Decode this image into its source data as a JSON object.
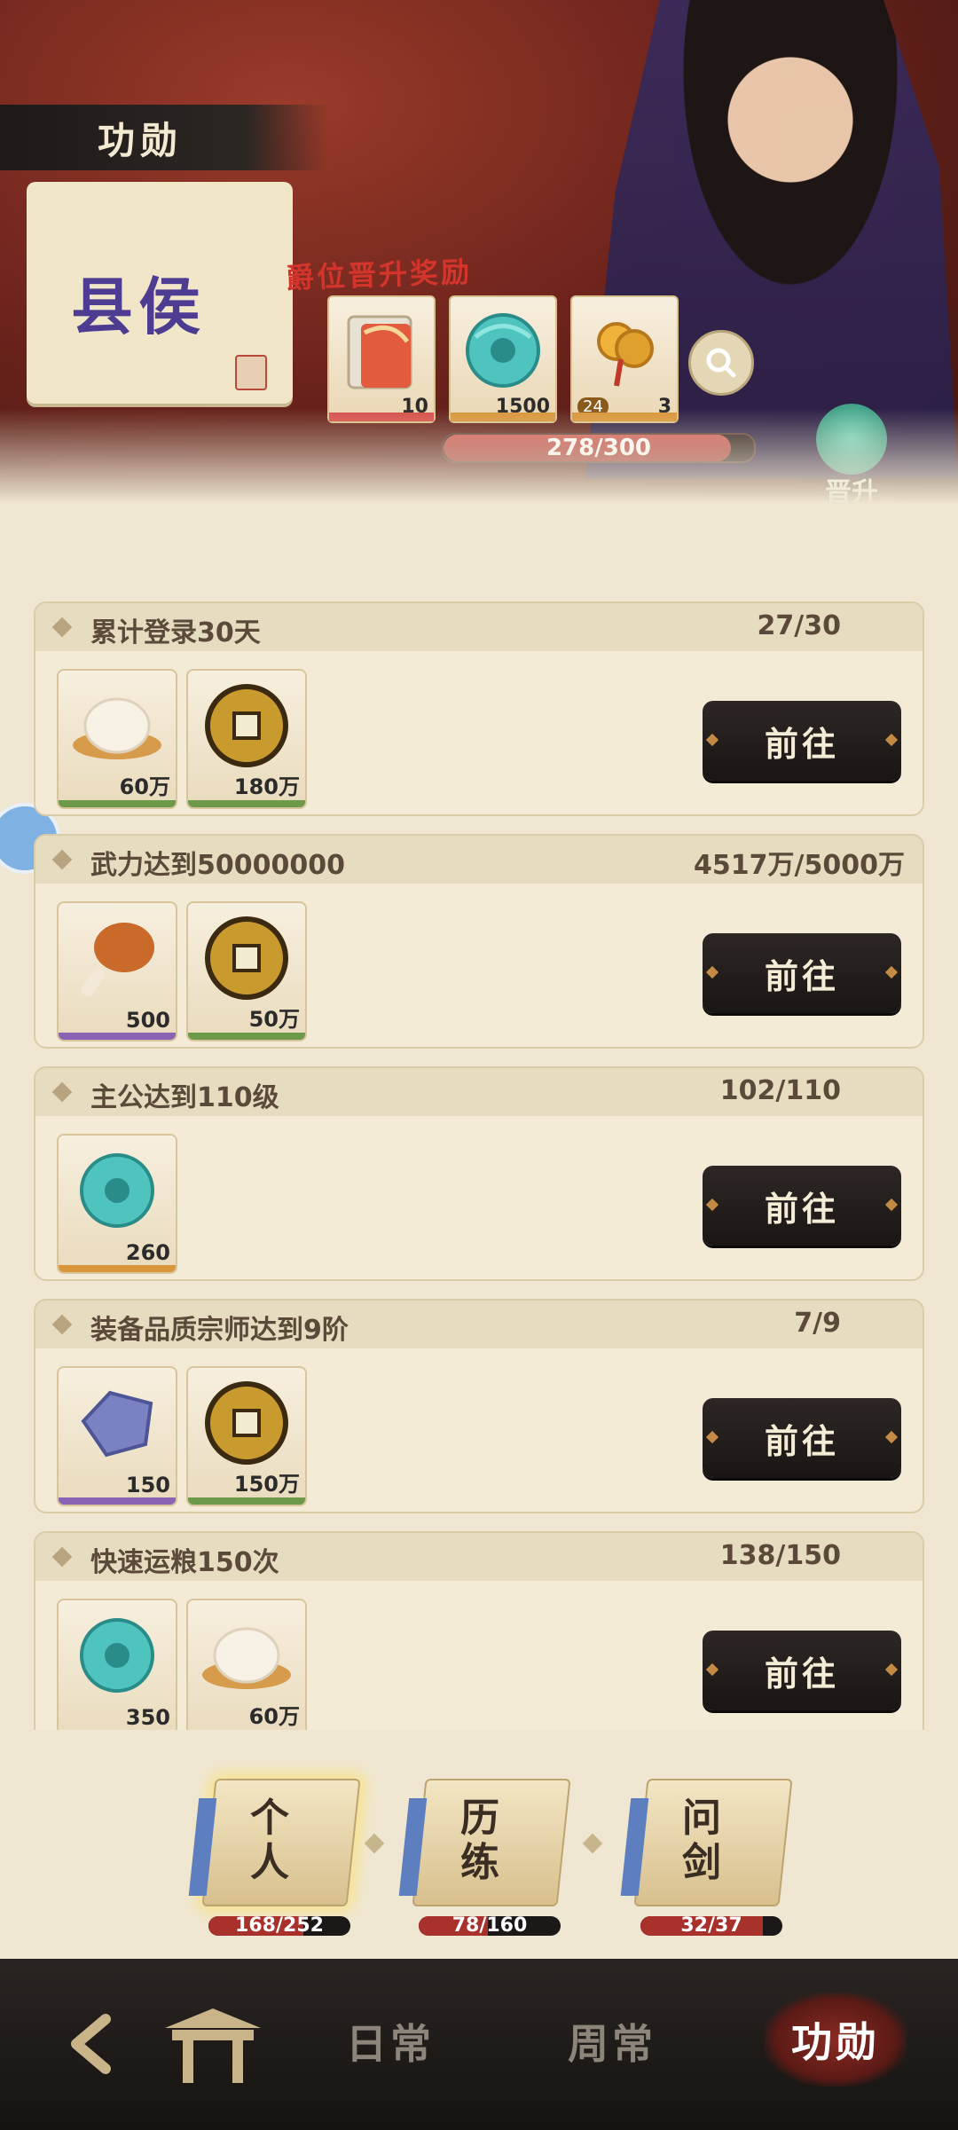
{
  "header": {
    "title": "功勋",
    "rank": "县侯",
    "reward_label": "爵位晋升奖励",
    "rewards": [
      {
        "icon": "scroll-pack-icon",
        "count": "10",
        "rarity_color": "#d6504a"
      },
      {
        "icon": "jade-dragon-icon",
        "count": "1500",
        "rarity_color": "#d8953a"
      },
      {
        "icon": "coin-string-icon",
        "level": "24",
        "count": "3",
        "rarity_color": "#d8953a"
      }
    ],
    "progress": {
      "text": "278/300",
      "fraction": 0.9267
    },
    "promote_label": "晋升"
  },
  "tasks": [
    {
      "title": "累计登录30天",
      "progress": "27/30",
      "button": "前往",
      "items": [
        {
          "icon": "steamed-bun-icon",
          "count": "60万",
          "rarity_color": "#6d9a4a"
        },
        {
          "icon": "copper-coin-icon",
          "count": "180万",
          "rarity_color": "#6d9a4a"
        }
      ]
    },
    {
      "title": "武力达到50000000",
      "progress": "4517万/5000万",
      "button": "前往",
      "items": [
        {
          "icon": "chicken-leg-icon",
          "count": "500",
          "rarity_color": "#8a63b5"
        },
        {
          "icon": "copper-coin-icon",
          "count": "50万",
          "rarity_color": "#6d9a4a"
        }
      ]
    },
    {
      "title": "主公达到110级",
      "progress": "102/110",
      "button": "前往",
      "items": [
        {
          "icon": "jade-dragon-icon",
          "count": "260",
          "rarity_color": "#d8953a"
        }
      ]
    },
    {
      "title": "装备品质宗师达到9阶",
      "progress": "7/9",
      "button": "前往",
      "items": [
        {
          "icon": "ore-stone-icon",
          "count": "150",
          "rarity_color": "#8a63b5"
        },
        {
          "icon": "copper-coin-icon",
          "count": "150万",
          "rarity_color": "#6d9a4a"
        }
      ]
    },
    {
      "title": "快速运粮150次",
      "progress": "138/150",
      "button": "前往",
      "items": [
        {
          "icon": "jade-dragon-icon",
          "count": "350",
          "rarity_color": "#d8953a"
        },
        {
          "icon": "steamed-bun-icon",
          "count": "60万",
          "rarity_color": "#6d9a4a"
        }
      ]
    }
  ],
  "categories": [
    {
      "label": "个人",
      "progress": "168/252",
      "fraction": 0.6667,
      "selected": true
    },
    {
      "label": "历练",
      "progress": "78/160",
      "fraction": 0.4875,
      "selected": false
    },
    {
      "label": "问剑",
      "progress": "32/37",
      "fraction": 0.8649,
      "selected": false
    }
  ],
  "bottom_nav": {
    "back_icon": "back-arrow-icon",
    "home_icon": "home-gate-icon",
    "daily": "日常",
    "weekly": "周常",
    "merit": "功勋"
  }
}
